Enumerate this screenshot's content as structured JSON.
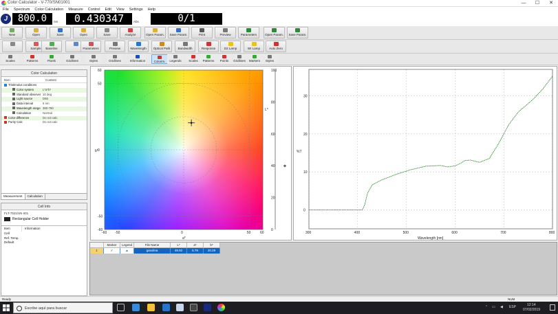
{
  "window": {
    "title": "Color Calculator - V-770/SN01001",
    "minimize": "—",
    "maximize": "☐",
    "close": "✕"
  },
  "menu": [
    "File",
    "Spectrum",
    "Color Calculation",
    "Measure",
    "Control",
    "Edit",
    "View",
    "Settings",
    "Help"
  ],
  "readout": {
    "wavelength_value": "800.0",
    "wavelength_unit": "nm",
    "absorbance_value": "0.430347",
    "absorbance_unit": "Abs",
    "counter_value": "0/1"
  },
  "toolbar1": [
    {
      "label": "New",
      "icon": "new-icon",
      "color": "#7a6"
    },
    {
      "label": "Open",
      "icon": "open-icon",
      "color": "#dcb040"
    },
    {
      "label": "Save",
      "icon": "save-icon",
      "color": "#3a6fc0"
    },
    {
      "label": "Open",
      "icon": "open-folder-icon",
      "color": "#dcb040"
    },
    {
      "label": "Save",
      "icon": "save-disk-icon",
      "color": "#888"
    },
    {
      "label": "Analyze",
      "icon": "analyze-icon",
      "color": "#c44"
    },
    {
      "label": "Open Param.",
      "icon": "open-param-icon",
      "color": "#dcb040"
    },
    {
      "label": "Save Param.",
      "icon": "save-param-icon",
      "color": "#3a6fc0"
    },
    {
      "label": "Print",
      "icon": "print-icon",
      "color": "#555"
    },
    {
      "label": "Preview",
      "icon": "preview-icon",
      "color": "#777"
    },
    {
      "label": "Parameters",
      "icon": "parameters-icon",
      "color": "#2a8a3a"
    },
    {
      "label": "Open Param.",
      "icon": "open-param2-icon",
      "color": "#2a8a3a"
    },
    {
      "label": "Save Param.",
      "icon": "save-param2-icon",
      "color": "#2a8a3a"
    }
  ],
  "toolbar2": [
    {
      "label": "",
      "icon": "tool-a-icon",
      "color": "#888"
    },
    {
      "label": "Sample",
      "icon": "sample-icon",
      "color": "#d55"
    },
    {
      "label": "Baseline",
      "icon": "baseline-icon",
      "color": "#5a5"
    },
    {
      "label": "",
      "icon": "tool-b-icon",
      "color": "#58c"
    },
    {
      "label": "Parameters",
      "icon": "parameters2-icon",
      "color": "#c55"
    },
    {
      "label": "Preview",
      "icon": "preview2-icon",
      "color": "#777"
    },
    {
      "label": "Wavelength",
      "icon": "wavelength-icon",
      "color": "#27c"
    },
    {
      "label": "Optical Path",
      "icon": "optical-path-icon",
      "color": "#c82"
    },
    {
      "label": "Bandwidth",
      "icon": "bandwidth-icon",
      "color": "#777"
    },
    {
      "label": "Response",
      "icon": "response-icon",
      "color": "#c33"
    },
    {
      "label": "D2 Lamp",
      "icon": "d2-lamp-icon",
      "color": "#e9c21b"
    },
    {
      "label": "WI Lamp",
      "icon": "wi-lamp-icon",
      "color": "#e9c21b"
    },
    {
      "label": "Auto Zero",
      "icon": "auto-zero-icon",
      "color": "#c33"
    }
  ],
  "toolbar3": [
    {
      "label": "Scales",
      "icon": "scales-icon",
      "color": "#777"
    },
    {
      "label": "Patterns",
      "icon": "patterns-icon",
      "color": "#c33"
    },
    {
      "label": "Pixels",
      "icon": "pixels-icon",
      "color": "#3a3"
    },
    {
      "label": "Gridlines",
      "icon": "gridlines-icon",
      "color": "#777"
    },
    {
      "label": "Styles",
      "icon": "styles-icon",
      "color": "#777"
    },
    {
      "label": "Gridlines",
      "icon": "gridlines2-icon",
      "color": "#777"
    },
    {
      "label": "Information",
      "icon": "information-icon",
      "color": "#1a4fb3"
    },
    {
      "label": "Colorim.",
      "icon": "colorimetry-icon",
      "color": "#c33"
    },
    {
      "label": "Legends",
      "icon": "legends-icon",
      "color": "#777"
    },
    {
      "label": "Scales",
      "icon": "scales2-icon",
      "color": "#c33"
    },
    {
      "label": "Patterns",
      "icon": "patterns2-icon",
      "color": "#3a3"
    },
    {
      "label": "Points",
      "icon": "points-icon",
      "color": "#c33"
    },
    {
      "label": "Gridlines",
      "icon": "gridlines3-icon",
      "color": "#777"
    },
    {
      "label": "Markers",
      "icon": "markers-icon",
      "color": "#3a3"
    },
    {
      "label": "Styles",
      "icon": "styles2-icon",
      "color": "#777"
    }
  ],
  "color_calc_panel": {
    "title": "Color Calculation",
    "col_item": "Item",
    "col_content": "Content",
    "rows": [
      {
        "key": "Tristimulus conditions",
        "value": "",
        "level": 0,
        "icon": "#2a7fd0"
      },
      {
        "key": "Color system",
        "value": "L*a*b*",
        "level": 1,
        "icon": "#666"
      },
      {
        "key": "Standard observer",
        "value": "10 deg",
        "level": 1,
        "icon": "#666"
      },
      {
        "key": "Light source",
        "value": "D65",
        "level": 1,
        "icon": "#666"
      },
      {
        "key": "Data interval",
        "value": "5 nm",
        "level": 1,
        "icon": "#666"
      },
      {
        "key": "Wavelength range",
        "value": "380-780",
        "level": 1,
        "icon": "#666"
      },
      {
        "key": "Calculation",
        "value": "Normal",
        "level": 1,
        "icon": "#666"
      },
      {
        "key": "Color difference",
        "value": "Do not calc",
        "level": 0,
        "icon": "#c33"
      },
      {
        "key": "Purity Calc",
        "value": "Do not calc",
        "level": 0,
        "icon": "#c33"
      }
    ],
    "tab_measurement": "Measurement",
    "tab_calculation": "Calculation"
  },
  "cell_panel": {
    "title": "Cell Info",
    "device": "FLT-7521/SN 001",
    "holder": "Rectangular Cell Holder",
    "col_item": "Item",
    "col_info": "Information",
    "rows": [
      "Cell",
      "Ref. Temp.",
      "Default"
    ]
  },
  "chromaticity": {
    "xlabel": "a*",
    "ylabel": "b*",
    "right_label": "L*",
    "x_ticks": [
      "-60",
      "-50",
      "0",
      "50",
      "60"
    ],
    "y_ticks": [
      "60",
      "50",
      "0",
      "-50",
      "-60"
    ],
    "l_ticks": [
      "100",
      "80",
      "60",
      "40",
      "20",
      "0"
    ],
    "point": {
      "a": 5.8,
      "b": 20.3
    },
    "l_marker": 39.9
  },
  "chart_data": {
    "type": "line",
    "xlabel": "Wavelength [nm]",
    "ylabel": "%T",
    "xlim": [
      300,
      800
    ],
    "ylim": [
      -5,
      37
    ],
    "x_ticks": [
      300,
      400,
      500,
      600,
      700,
      800
    ],
    "y_ticks": [
      0,
      10,
      20,
      30
    ],
    "series": [
      {
        "x": [
          300,
          350,
          400,
          410,
          415,
          420,
          430,
          450,
          480,
          510,
          540,
          570,
          585,
          600,
          612,
          620,
          632,
          650,
          670,
          690,
          710,
          730,
          760,
          780,
          800
        ],
        "y": [
          0,
          0,
          0,
          0,
          1.5,
          4.3,
          6.6,
          7.9,
          9.4,
          10.6,
          11.5,
          11.7,
          11.3,
          11.6,
          12.3,
          13.0,
          13.1,
          12.5,
          13.5,
          17.6,
          22.4,
          25.8,
          29.1,
          31.8,
          35.2
        ]
      }
    ]
  },
  "grid": {
    "headers": [
      "",
      "Marker",
      "Legend",
      "File Name",
      "L*",
      "a*",
      "b*"
    ],
    "row": {
      "index": "1",
      "marker": "✓",
      "legend": "▲",
      "file": "gasolina",
      "L": "49.92",
      "a": "5.79",
      "b": "20.29"
    }
  },
  "status_left": "Ready",
  "status_right": "NUM",
  "taskbar": {
    "search_placeholder": "Escribe aquí para buscar",
    "language": "ESP",
    "time": "12:14",
    "date": "07/02/2019"
  }
}
